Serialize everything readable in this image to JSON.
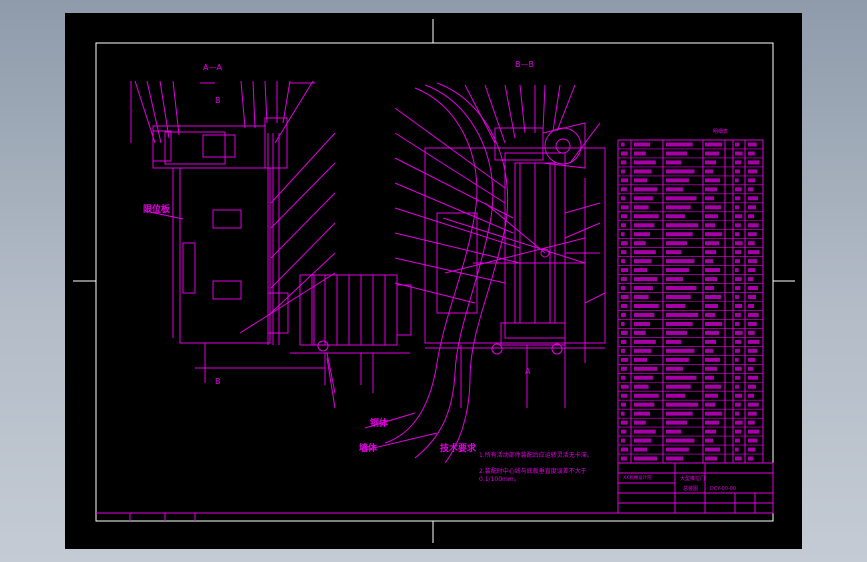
{
  "drawing": {
    "section_labels": {
      "left": "A—A",
      "right": "B—B"
    },
    "view_markers": {
      "left_top": "B",
      "left_bottom": "B",
      "right_bottom": "A"
    },
    "side_labels": {
      "motor_side": "限位板",
      "body": "钢体",
      "wall": "墙体"
    },
    "tech_requirements": {
      "title": "技术要求",
      "items": [
        "1.所有活动部件装配后应运转灵活无卡滞。",
        "2.装配时中心线与底板垂直度误差不大于0.1/100mm。"
      ]
    },
    "title_block": {
      "name_line1": "大型推拉门",
      "name_line2": "总装图",
      "drawing_no": "DCY-00-00",
      "company": "XX机械设计院"
    },
    "bom_header": "明细表",
    "colors": {
      "line": "#e000e0",
      "frame": "#ffffff",
      "background": "#000000",
      "dim": "#9a1a9a"
    }
  }
}
